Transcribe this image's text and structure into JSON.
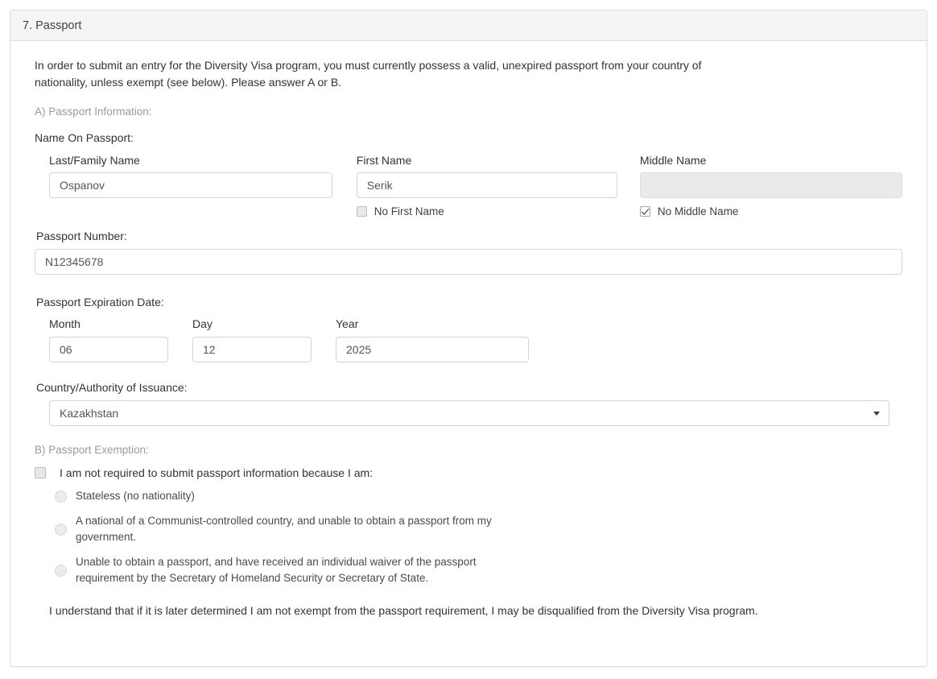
{
  "panel": {
    "title": "7. Passport",
    "intro": "In order to submit an entry for the Diversity Visa program, you must currently possess a valid, unexpired passport from your country of nationality, unless exempt (see below). Please answer A or B."
  },
  "section_a": {
    "label": "A) Passport Information:",
    "name_group_title": "Name On Passport:",
    "last_name": {
      "label": "Last/Family Name",
      "value": "Ospanov",
      "placeholder": ""
    },
    "first_name": {
      "label": "First Name",
      "value": "Serik",
      "placeholder": "",
      "checkbox_label": "No First Name",
      "checkbox_checked": false
    },
    "middle_name": {
      "label": "Middle Name",
      "value": "",
      "placeholder": "",
      "disabled": true,
      "checkbox_label": "No Middle Name",
      "checkbox_checked": true
    },
    "passport_number": {
      "label": "Passport Number:",
      "value": "N12345678",
      "placeholder": ""
    },
    "expiration": {
      "label": "Passport Expiration Date:",
      "month": {
        "label": "Month",
        "value": "06"
      },
      "day": {
        "label": "Day",
        "value": "12"
      },
      "year": {
        "label": "Year",
        "value": "2025"
      }
    },
    "country": {
      "label": "Country/Authority of Issuance:",
      "selected": "Kazakhstan",
      "arrow_icon": "chevron-down-icon"
    }
  },
  "section_b": {
    "label": "B) Passport Exemption:",
    "main_checkbox": {
      "label": "I am not required to submit passport information because I am:",
      "checked": false
    },
    "options": [
      {
        "label": "Stateless (no nationality)",
        "selected": false
      },
      {
        "label": "A national of a Communist-controlled country, and unable to obtain a passport from my government.",
        "selected": false
      },
      {
        "label": "Unable to obtain a passport, and have received an individual waiver of the passport requirement by the Secretary of Homeland Security or Secretary of State.",
        "selected": false
      }
    ],
    "closing_statement": "I understand that if it is later determined I am not exempt from the passport requirement, I may be disqualified from the Diversity Visa program."
  },
  "colors": {
    "panel_border": "#dddddd",
    "heading_bg": "#f5f5f5",
    "input_border": "#d5d5d5",
    "disabled_bg": "#eaeaea",
    "muted_text": "#9b9b9b"
  }
}
